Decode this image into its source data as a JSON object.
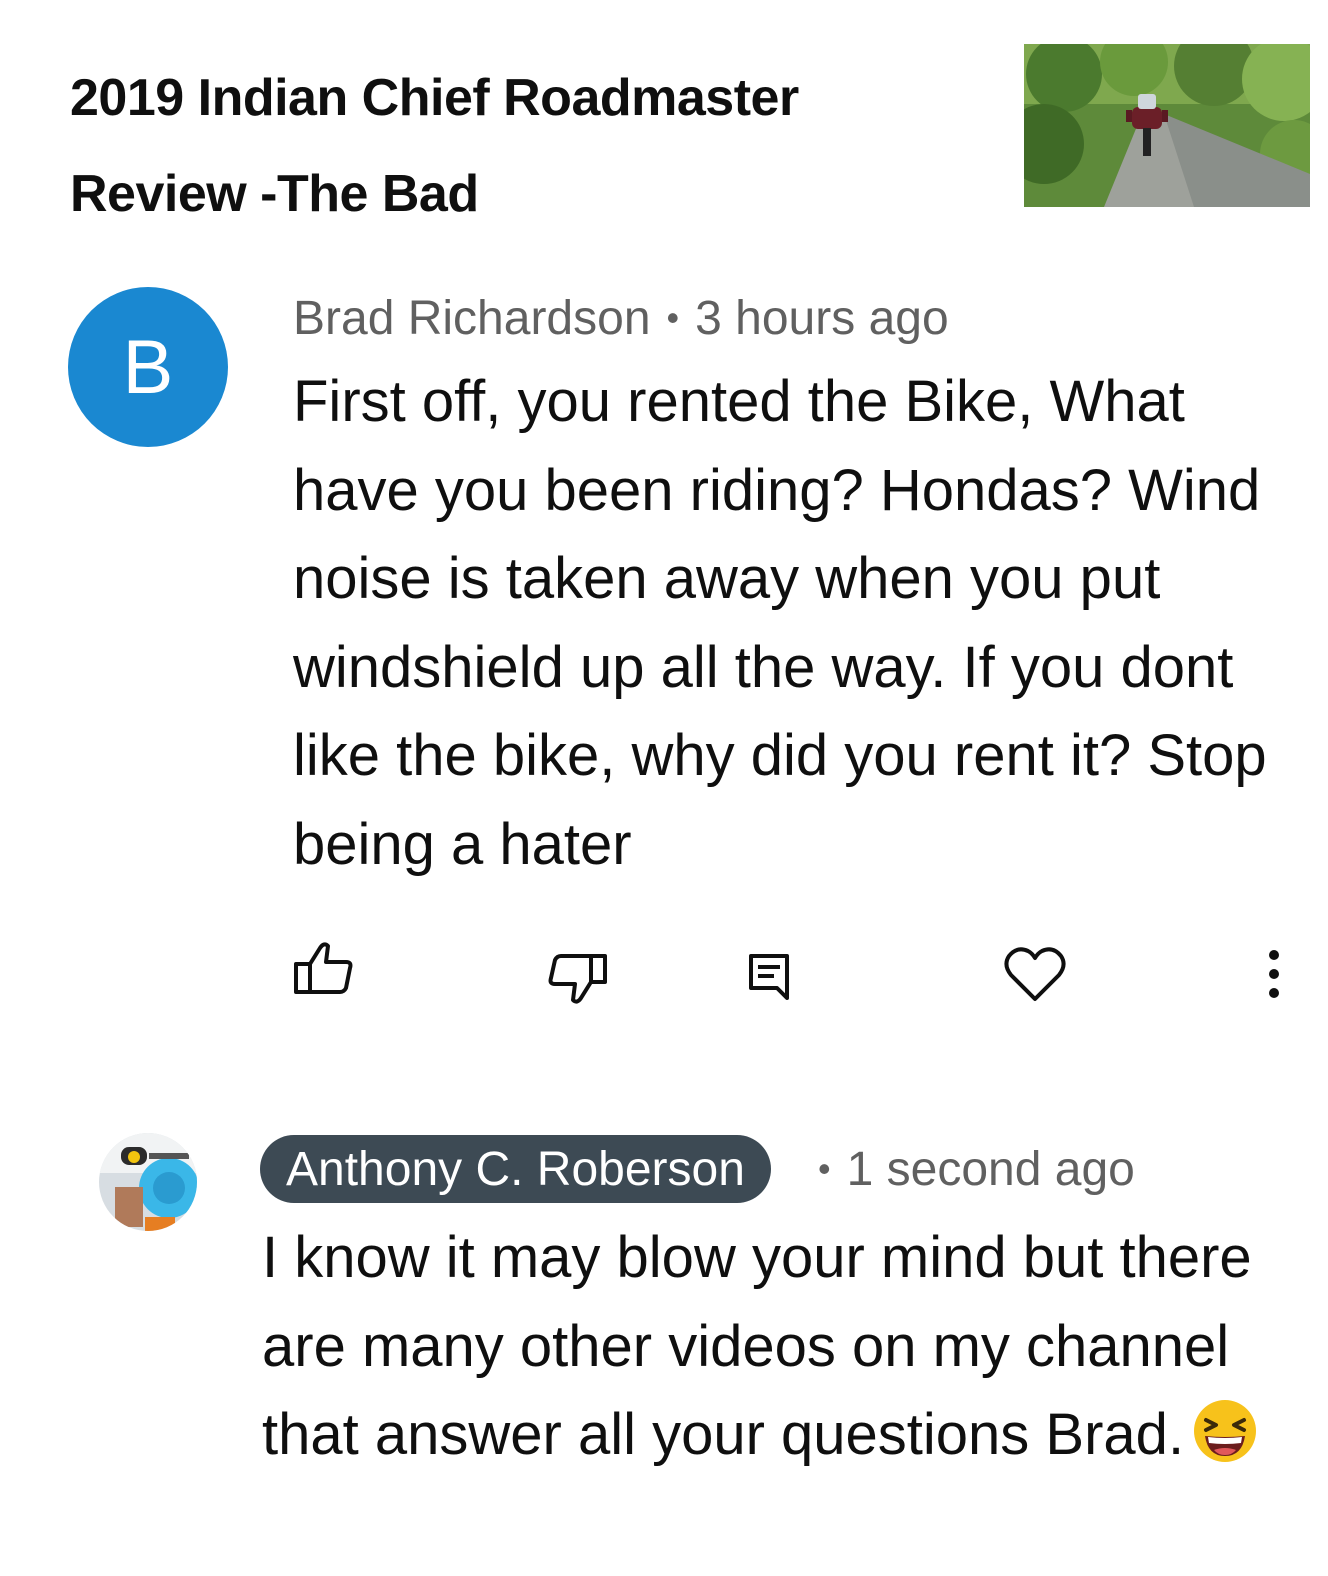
{
  "video": {
    "title": "2019 Indian Chief Roadmaster Review -The Bad",
    "thumbnail_icon": "motorcycle-on-road-thumbnail"
  },
  "comment": {
    "avatar_letter": "B",
    "avatar_color": "#1a88d1",
    "author": "Brad Richardson",
    "separator": "•",
    "time": "3 hours ago",
    "text": "First off, you rented the Bike, What have you been riding? Hondas? Wind noise is taken away when you put windshield up all the way. If you dont like the bike, why did you rent it? Stop being a hater",
    "actions": {
      "like_icon": "thumbs-up-icon",
      "dislike_icon": "thumbs-down-icon",
      "reply_icon": "reply-comment-icon",
      "heart_icon": "heart-icon",
      "more_icon": "more-vertical-icon"
    }
  },
  "reply": {
    "author": "Anthony C. Roberson",
    "author_chip_color": "#3d4a54",
    "separator": "•",
    "time": "1 second ago",
    "text": "I know it may blow your mind but there are many other videos on my channel that answer all your questions Brad.",
    "emoji": "😆"
  }
}
